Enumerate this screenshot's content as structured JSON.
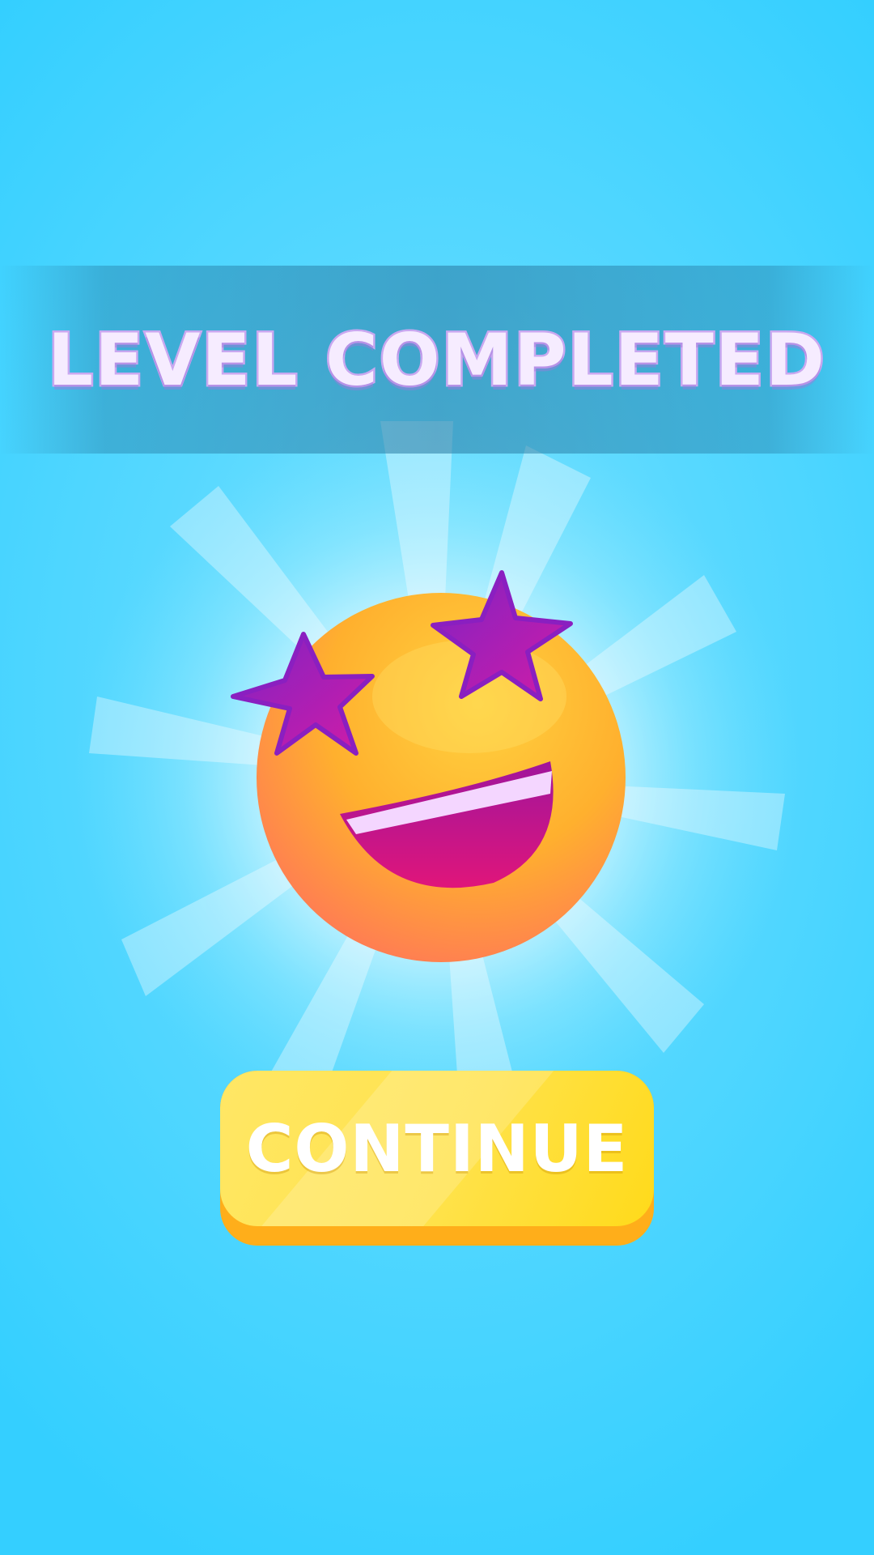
{
  "screen": {
    "title": "LEVEL COMPLETED",
    "continue_label": "CONTINUE"
  },
  "icons": {
    "mascot": "star-struck-emoji-icon",
    "background": "light-burst-icon"
  },
  "colors": {
    "background_top": "#34cfff",
    "background_center": "#7fe4ff",
    "title_fill": "#f6ecff",
    "title_outline": "#c9a8f0",
    "button_face": "#ffe24a",
    "button_base": "#ffae1a",
    "emoji_face": "#ffb833",
    "emoji_star": "#a11cc9"
  }
}
